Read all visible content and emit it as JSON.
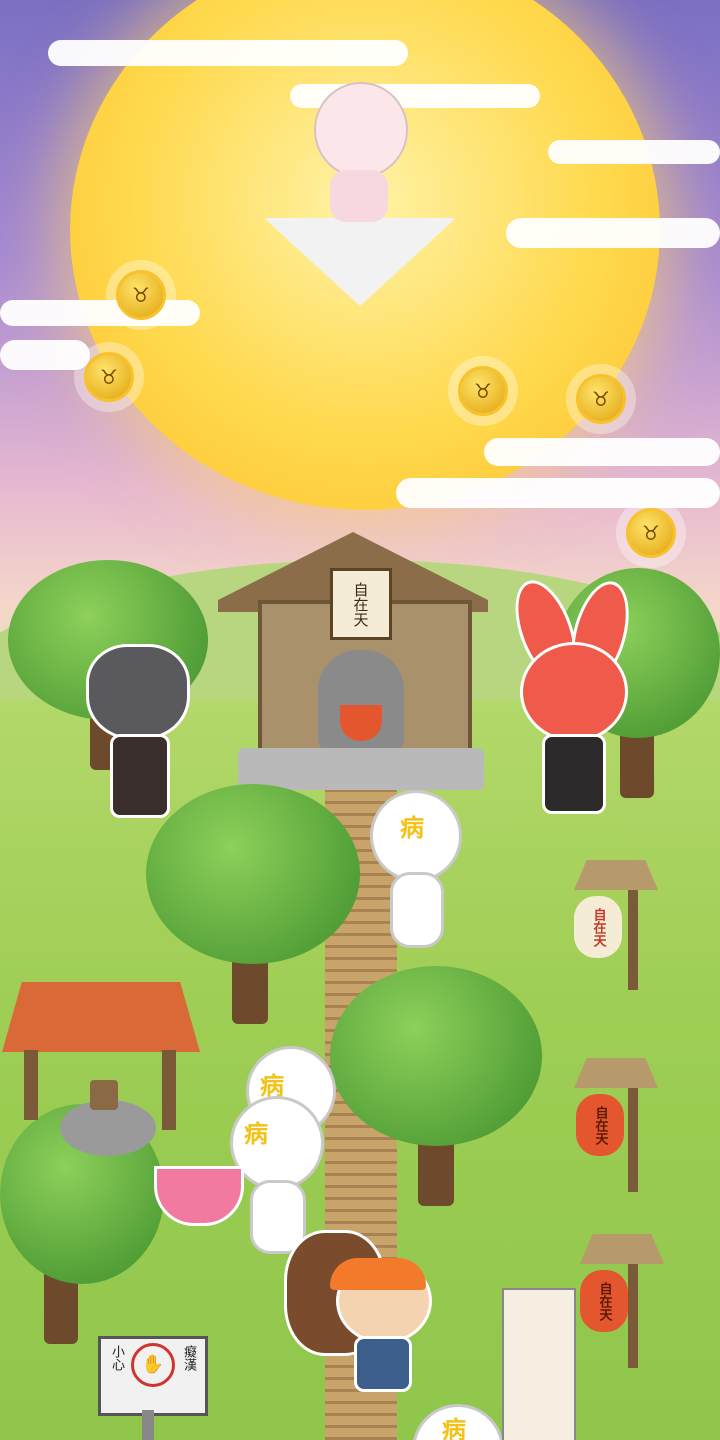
{
  "scene": {
    "shrine_sign_text": "自在天",
    "lantern_text": "自在天",
    "sick_label": "病",
    "warning_sign": {
      "left_text": "小心",
      "right_text": "癡漢",
      "icon": "no-hand-icon"
    }
  },
  "coins": {
    "icon": "rabbit-coin-icon",
    "glyph": "♉"
  },
  "colors": {
    "moon": "#ffd94d",
    "grass": "#9fce55",
    "lantern_red": "#e4572e",
    "lantern_white": "#f4ecd4",
    "sick_text": "#f2c316"
  }
}
